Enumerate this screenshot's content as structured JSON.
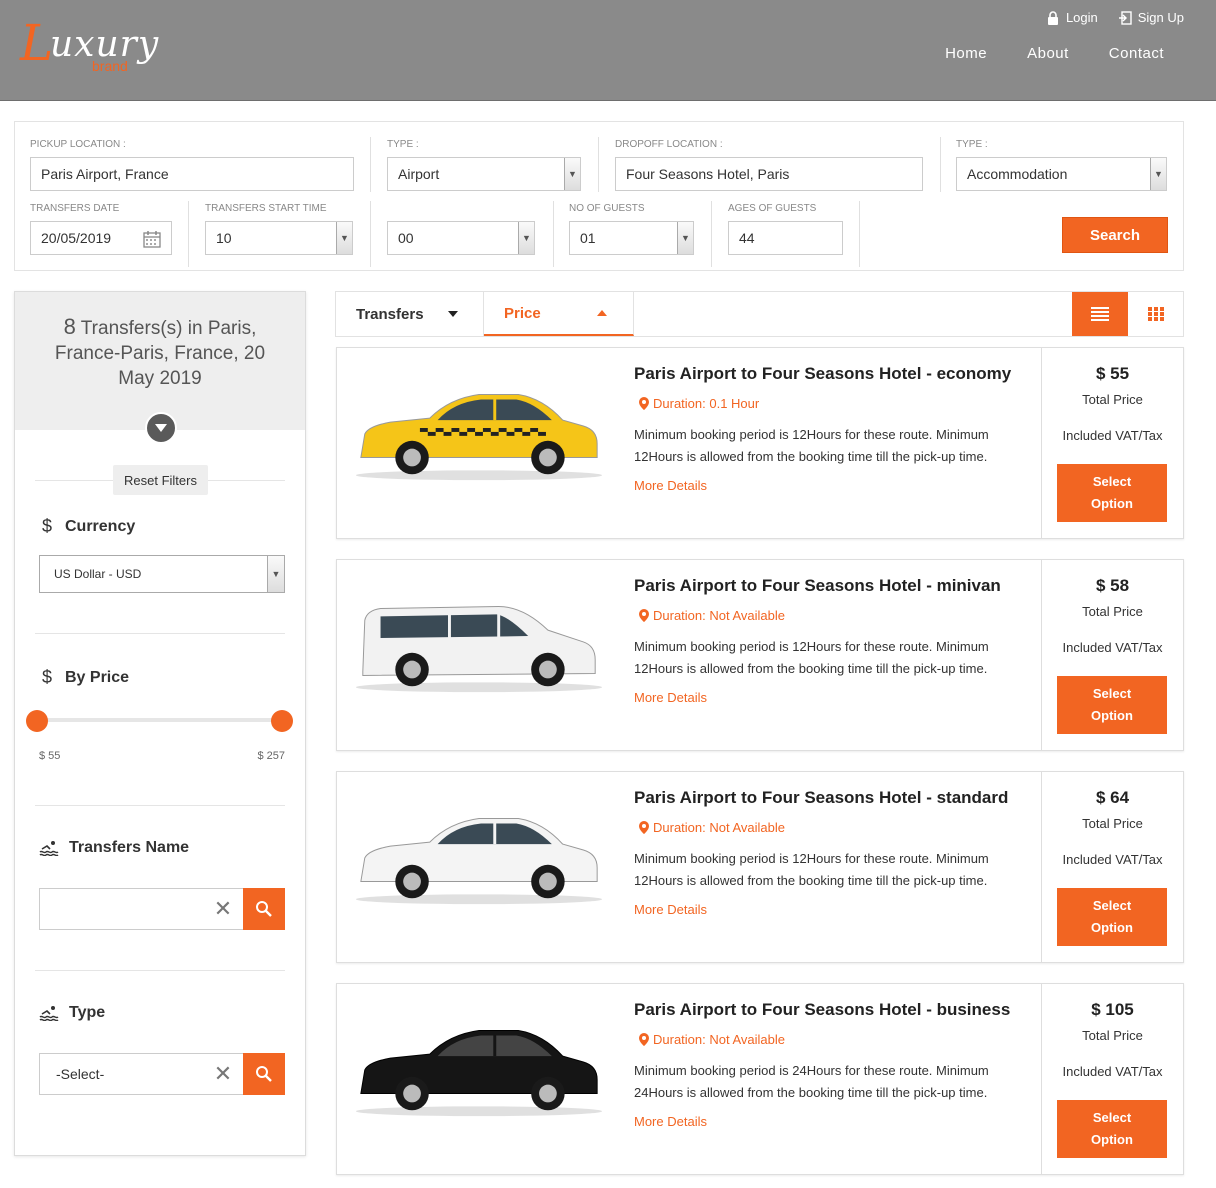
{
  "brand": {
    "logo_initial": "L",
    "logo_rest": "uxury",
    "logo_sub": "brand",
    "accent": "#f26522"
  },
  "header": {
    "login": "Login",
    "signup": "Sign Up",
    "nav": [
      "Home",
      "About",
      "Contact"
    ]
  },
  "search": {
    "pickup_label": "PICKUP LOCATION :",
    "pickup_value": "Paris Airport, France",
    "type1_label": "TYPE :",
    "type1_value": "Airport",
    "dropoff_label": "DROPOFF LOCATION :",
    "dropoff_value": "Four Seasons Hotel, Paris",
    "type2_label": "TYPE :",
    "type2_value": "Accommodation",
    "date_label": "TRANSFERS DATE",
    "date_value": "20/05/2019",
    "start_label": "TRANSFERS START TIME",
    "hour_value": "10",
    "minute_value": "00",
    "guests_label": "NO OF GUESTS",
    "guests_value": "01",
    "ages_label": "AGES OF GUESTS",
    "ages_value": "44",
    "search_button": "Search"
  },
  "sidebar": {
    "count": "8",
    "summary": "Transfers(s) in Paris, France-Paris, France, 20 May 2019",
    "reset": "Reset Filters",
    "currency_title": "Currency",
    "currency_value": "US Dollar - USD",
    "price_title": "By Price",
    "price_min": "$ 55",
    "price_max": "$ 257",
    "name_title": "Transfers Name",
    "name_value": "",
    "type_title": "Type",
    "type_value": "-Select-"
  },
  "sort": {
    "tab1": "Transfers",
    "tab2": "Price"
  },
  "results": [
    {
      "title": "Paris Airport to Four Seasons Hotel - economy",
      "duration": "Duration: 0.1 Hour",
      "desc": "Minimum booking period is 12Hours for these route. Minimum 12Hours is allowed from the booking time till the pick-up time.",
      "more": "More Details",
      "price": "$ 55",
      "total": "Total Price",
      "vat": "Included VAT/Tax",
      "select": "Select Option",
      "car": "yellow-taxi",
      "car_color": "#f5c518"
    },
    {
      "title": "Paris Airport to Four Seasons Hotel - minivan",
      "duration": "Duration: Not Available",
      "desc": "Minimum booking period is 12Hours for these route. Minimum 12Hours is allowed from the booking time till the pick-up time.",
      "more": "More Details",
      "price": "$ 58",
      "total": "Total Price",
      "vat": "Included VAT/Tax",
      "select": "Select Option",
      "car": "white-minivan",
      "car_color": "#f2f2f2"
    },
    {
      "title": "Paris Airport to Four Seasons Hotel - standard",
      "duration": "Duration: Not Available",
      "desc": "Minimum booking period is 12Hours for these route. Minimum 12Hours is allowed from the booking time till the pick-up time.",
      "more": "More Details",
      "price": "$ 64",
      "total": "Total Price",
      "vat": "Included VAT/Tax",
      "select": "Select Option",
      "car": "white-sedan",
      "car_color": "#f4f4f4"
    },
    {
      "title": "Paris Airport to Four Seasons Hotel - business",
      "duration": "Duration: Not Available",
      "desc": "Minimum booking period is 24Hours for these route. Minimum 24Hours is allowed from the booking time till the pick-up time.",
      "more": "More Details",
      "price": "$ 105",
      "total": "Total Price",
      "vat": "Included VAT/Tax",
      "select": "Select Option",
      "car": "black-sedan",
      "car_color": "#151515"
    }
  ]
}
